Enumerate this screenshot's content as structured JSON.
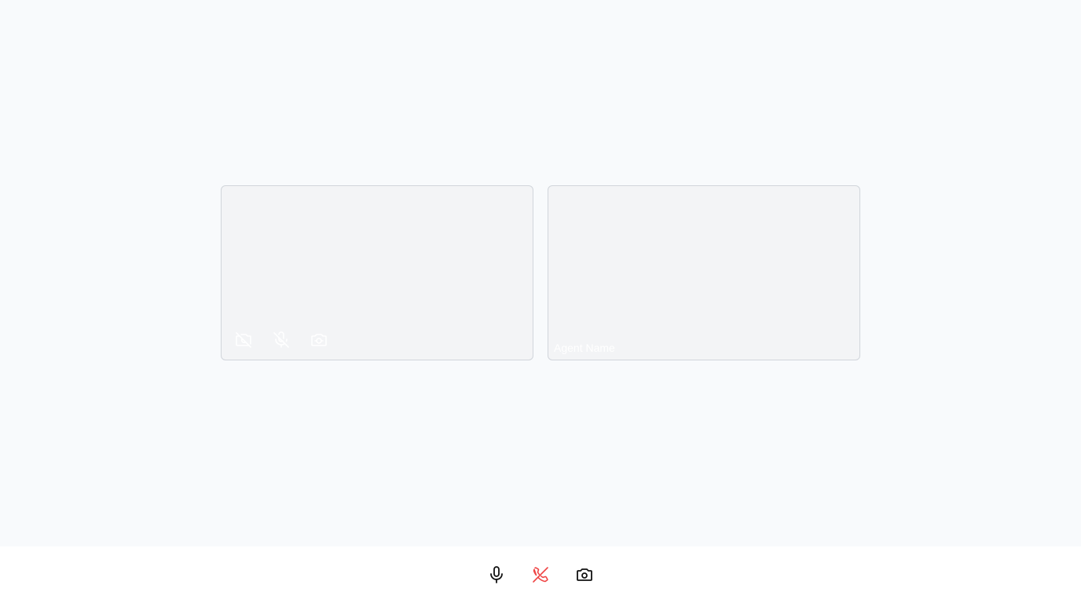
{
  "local_tile": {
    "controls": [
      {
        "icon": "camera-off-icon"
      },
      {
        "icon": "microphone-off-icon"
      },
      {
        "icon": "switch-camera-icon"
      }
    ]
  },
  "remote_tile": {
    "agent_name": "Agent Name"
  },
  "call_bar": {
    "buttons": [
      {
        "icon": "microphone-icon"
      },
      {
        "icon": "end-call-icon",
        "color": "#ef4444"
      },
      {
        "icon": "camera-icon"
      }
    ]
  },
  "colors": {
    "background": "#f8fafc",
    "tile": "#f3f4f6",
    "tile_icon": "#ffffff",
    "end_call": "#ef4444",
    "icon": "#111111"
  }
}
